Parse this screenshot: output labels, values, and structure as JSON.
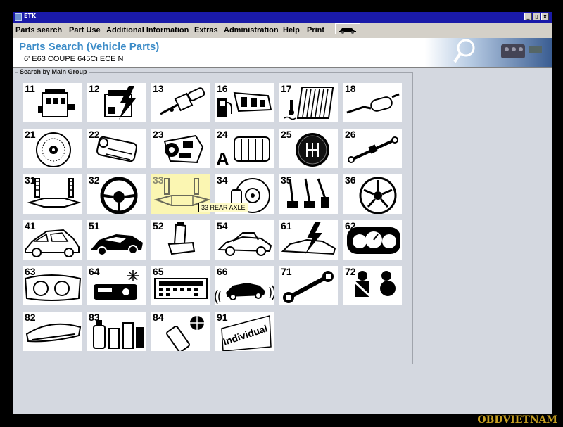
{
  "window": {
    "title": "ETK",
    "controls": [
      "_",
      "▯",
      "x"
    ]
  },
  "menu": [
    "Parts search",
    "Part Use",
    "Additional Information",
    "Extras",
    "Administration",
    "Help",
    "Print"
  ],
  "header": {
    "title": "Parts Search (Vehicle Parts)",
    "vehicle": "6' E63 COUPE 645Ci ECE  N"
  },
  "panel_label": "Search by Main Group",
  "groups": [
    {
      "num": "11",
      "icon": "engine-block-icon"
    },
    {
      "num": "12",
      "icon": "engine-electrical-icon"
    },
    {
      "num": "13",
      "icon": "fuel-injector-icon"
    },
    {
      "num": "16",
      "icon": "fuel-pump-tank-icon"
    },
    {
      "num": "17",
      "icon": "radiator-icon"
    },
    {
      "num": "18",
      "icon": "exhaust-muffler-icon"
    },
    {
      "num": "21",
      "icon": "clutch-disc-icon"
    },
    {
      "num": "22",
      "icon": "engine-transmission-mount-icon"
    },
    {
      "num": "23",
      "icon": "manual-gearbox-icon"
    },
    {
      "num": "24",
      "icon": "automatic-gearbox-icon",
      "badge": "A"
    },
    {
      "num": "25",
      "icon": "gearshift-knob-icon"
    },
    {
      "num": "26",
      "icon": "drive-shaft-icon"
    },
    {
      "num": "31",
      "icon": "front-axle-icon"
    },
    {
      "num": "32",
      "icon": "steering-wheel-icon"
    },
    {
      "num": "33",
      "icon": "rear-axle-icon"
    },
    {
      "num": "34",
      "icon": "brake-disc-icon"
    },
    {
      "num": "35",
      "icon": "pedals-icon"
    },
    {
      "num": "36",
      "icon": "wheel-rim-icon"
    },
    {
      "num": "41",
      "icon": "body-shell-icon"
    },
    {
      "num": "51",
      "icon": "vehicle-trim-icon"
    },
    {
      "num": "52",
      "icon": "seat-icon"
    },
    {
      "num": "54",
      "icon": "convertible-roof-icon"
    },
    {
      "num": "61",
      "icon": "vehicle-electrical-icon"
    },
    {
      "num": "62",
      "icon": "instrument-cluster-icon"
    },
    {
      "num": "63",
      "icon": "headlight-icon"
    },
    {
      "num": "64",
      "icon": "climate-control-icon"
    },
    {
      "num": "65",
      "icon": "audio-navigation-icon"
    },
    {
      "num": "66",
      "icon": "distance-systems-icon"
    },
    {
      "num": "71",
      "icon": "wrench-tool-icon"
    },
    {
      "num": "72",
      "icon": "restraint-airbag-icon"
    },
    {
      "num": "82",
      "icon": "roof-box-accessory-icon"
    },
    {
      "num": "83",
      "icon": "care-products-icon"
    },
    {
      "num": "84",
      "icon": "communication-systems-icon"
    },
    {
      "num": "91",
      "icon": "individual-icon",
      "text": "Individual"
    }
  ],
  "highlighted_group": "33",
  "tooltip": "33 REAR AXLE",
  "watermark": "OBDVIETNAM",
  "colors": {
    "title_bar": "#1a1aa8",
    "header_title": "#3c8cc8",
    "highlight": "#fbf6b2",
    "workspace": "#d4d8e0"
  }
}
